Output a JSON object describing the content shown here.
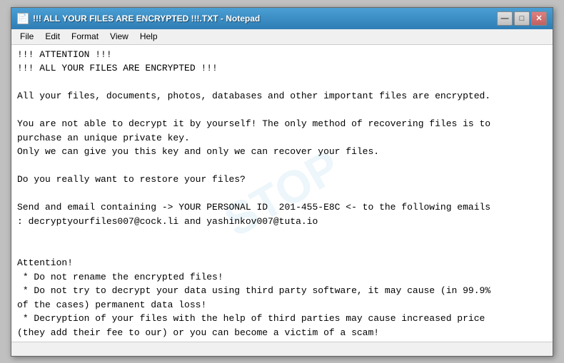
{
  "window": {
    "title": "!!! ALL YOUR FILES ARE ENCRYPTED !!!.TXT - Notepad",
    "icon_label": "📄"
  },
  "title_buttons": {
    "minimize": "—",
    "maximize": "□",
    "close": "✕"
  },
  "menu": {
    "items": [
      "File",
      "Edit",
      "Format",
      "View",
      "Help"
    ]
  },
  "content": {
    "text": "!!! ATTENTION !!!\n!!! ALL YOUR FILES ARE ENCRYPTED !!!\n\nAll your files, documents, photos, databases and other important files are encrypted.\n\nYou are not able to decrypt it by yourself! The only method of recovering files is to\npurchase an unique private key.\nOnly we can give you this key and only we can recover your files.\n\nDo you really want to restore your files?\n\nSend and email containing -> YOUR PERSONAL ID  201-455-E8C <- to the following emails\n: decryptyourfiles007@cock.li and yashinkov007@tuta.io\n\n\nAttention!\n * Do not rename the encrypted files!\n * Do not try to decrypt your data using third party software, it may cause (in 99.9%\nof the cases) permanent data loss!\n * Decryption of your files with the help of third parties may cause increased price\n(they add their fee to our) or you can become a victim of a scam!\n * WE ARE THE ONLY ONES THAT CAN DECRYPT YOUR FILES!!!"
  },
  "watermark": {
    "text": "STOP"
  }
}
